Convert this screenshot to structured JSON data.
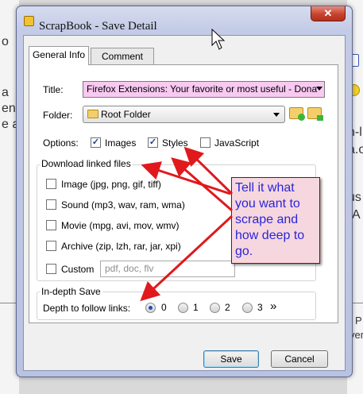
{
  "window": {
    "title": "ScrapBook - Save Detail",
    "close_glyph": "✕"
  },
  "tabs": [
    {
      "label": "General Info",
      "active": true
    },
    {
      "label": "Comment",
      "active": false
    }
  ],
  "form": {
    "title_label": "Title:",
    "title_value": "Firefox Extensions: Your favorite or most useful - Dona",
    "folder_label": "Folder:",
    "folder_value": "Root Folder",
    "options_label": "Options:",
    "options": [
      {
        "label": "Images",
        "checked": true
      },
      {
        "label": "Styles",
        "checked": true
      },
      {
        "label": "JavaScript",
        "checked": false
      }
    ]
  },
  "download_group": {
    "title": "Download linked files",
    "items": [
      {
        "label": "Image (jpg, png, gif, tiff)",
        "checked": false
      },
      {
        "label": "Sound (mp3, wav, ram, wma)",
        "checked": false
      },
      {
        "label": "Movie (mpg, avi, mov, wmv)",
        "checked": false
      },
      {
        "label": "Archive (zip, lzh, rar, jar, xpi)",
        "checked": false
      },
      {
        "label": "Custom",
        "checked": false
      }
    ],
    "custom_placeholder": "pdf, doc, flv"
  },
  "depth_group": {
    "title": "In-depth Save",
    "label": "Depth to follow links:",
    "options": [
      "0",
      "1",
      "2",
      "3"
    ],
    "selected": "0",
    "more_glyph": "»"
  },
  "buttons": {
    "save": "Save",
    "cancel": "Cancel"
  },
  "annotation": {
    "text": "Tell it what you want to scrape and how deep to go."
  },
  "background_fragments": {
    "left_1": "o",
    "left_2": "a",
    "left_3": "en",
    "left_4": "e a",
    "right_1": "n-l",
    "right_2": "a.o",
    "right_3": "us",
    "right_4": "A",
    "right_5": "| P",
    "right_6": "ver"
  },
  "colors": {
    "accent_arrow": "#e0191c",
    "callout_text": "#2a25d8",
    "callout_bg": "#f6d7df",
    "title_field_bg": "#f8c9f1"
  }
}
